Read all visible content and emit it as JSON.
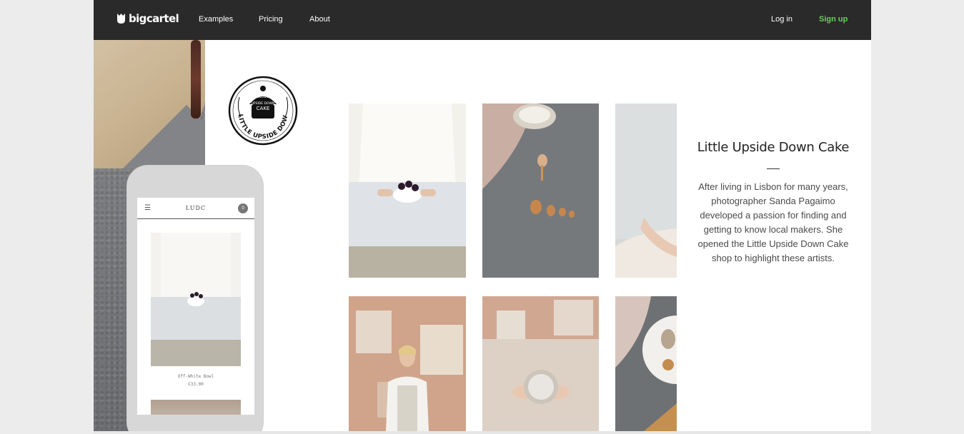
{
  "nav": {
    "brand": "bigcartel",
    "links": [
      "Examples",
      "Pricing",
      "About"
    ],
    "login": "Log in",
    "signup": "Sign up"
  },
  "badge": {
    "top_text": "Little",
    "middle_text": "UPSIDE DOWN",
    "bottom_text": "CAKE",
    "ring_text": "LITTLE UPSIDE DOWN CAKE"
  },
  "phone": {
    "shop_title": "LUDC",
    "cart_count": "0",
    "product_name": "Off-White Bowl",
    "product_price": "€33.00"
  },
  "store": {
    "title": "Little Upside Down Cake",
    "description": "After living in Lisbon for many years, photographer Sanda Pagaimo developed a passion for finding and getting to know local makers. She opened the Little Upside Down Cake shop to highlight these artists."
  },
  "colors": {
    "nav_bg": "#2a2a2a",
    "signup_green": "#66d05b",
    "page_bg": "#ececec"
  }
}
